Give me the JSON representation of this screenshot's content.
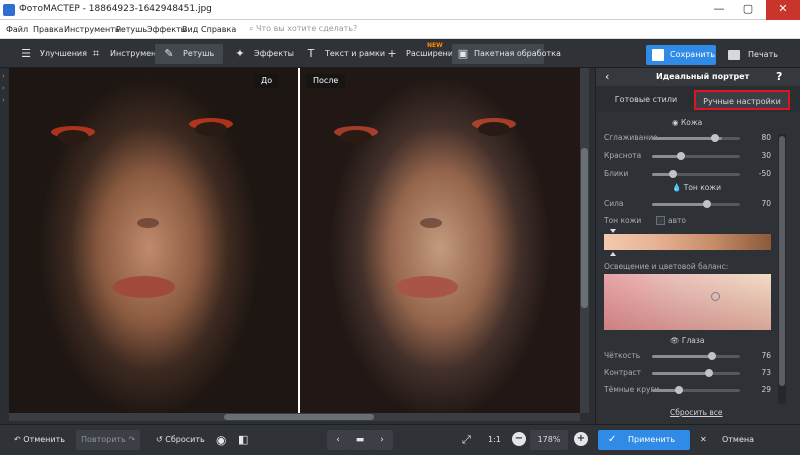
{
  "window": {
    "title": "ФотоМАСТЕР - 18864923-1642948451.jpg",
    "minimize": "—",
    "maximize": "▢",
    "close": "✕"
  },
  "menu": {
    "items": [
      "Файл",
      "Правка",
      "Инструменты",
      "Ретушь",
      "Эффекты",
      "Вид",
      "Справка"
    ],
    "search_placeholder": "Что вы хотите сделать?"
  },
  "toolbar": {
    "tabs": [
      "Улучшения",
      "Инструменты",
      "Ретушь",
      "Эффекты",
      "Текст и рамки",
      "Расширения",
      "Пакетная обработка"
    ],
    "active": "Ретушь",
    "new_badge": "NEW",
    "save": "Сохранить",
    "print": "Печать"
  },
  "canvas": {
    "before_label": "До",
    "after_label": "После"
  },
  "panel": {
    "title": "Идеальный портрет",
    "back": "‹",
    "help": "?",
    "tabs": [
      "Готовые стили",
      "Ручные настройки"
    ],
    "selected_tab": "Ручные настройки",
    "skin_header": "Кожа",
    "smoothing": {
      "label": "Сглаживание",
      "value": 80
    },
    "redness": {
      "label": "Краснота",
      "value": 30
    },
    "blemishes": {
      "label": "Блики",
      "value": -50
    },
    "skin_tone_header": "Тон кожи",
    "strength": {
      "label": "Сила",
      "value": 70
    },
    "skin_tone_label": "Тон кожи",
    "auto_label": "авто",
    "balance_label": "Освещение и цветовой баланс:",
    "eyes_header": "Глаза",
    "clarity": {
      "label": "Чёткость",
      "value": 76
    },
    "contrast": {
      "label": "Контраст",
      "value": 73
    },
    "dark_circles": {
      "label": "Тёмные круги",
      "value": 29
    },
    "reset_all": "Сбросить все"
  },
  "bottombar": {
    "undo": "Отменить",
    "redo": "Повторить",
    "reset": "Сбросить",
    "zoom_ratio": "1:1",
    "zoom_level": "178%",
    "apply": "Применить",
    "cancel": "Отмена"
  },
  "colors": {
    "accent": "#2f8be6",
    "highlight": "#e0141e",
    "new_badge": "#ff8a00"
  }
}
